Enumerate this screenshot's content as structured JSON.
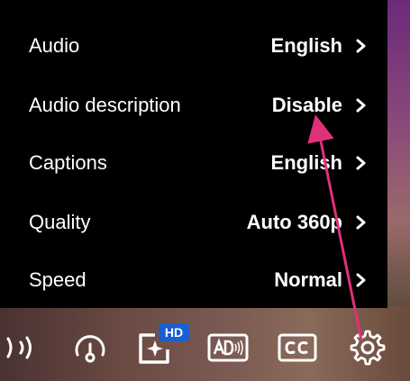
{
  "settings_menu": {
    "items": [
      {
        "label": "Audio",
        "value": "English"
      },
      {
        "label": "Audio description",
        "value": "Disable"
      },
      {
        "label": "Captions",
        "value": "English"
      },
      {
        "label": "Quality",
        "value": "Auto 360p"
      },
      {
        "label": "Speed",
        "value": "Normal"
      }
    ]
  },
  "controls": {
    "hd_badge": "HD",
    "icons": [
      "volume-icon",
      "speed-gauge-icon",
      "quality-sparkle-icon",
      "audio-description-icon",
      "closed-captions-icon",
      "gear-icon"
    ]
  },
  "colors": {
    "panel_bg": "#000000",
    "text": "#ffffff",
    "hd_badge": "#1a5fd0",
    "annotation_arrow": "#e0307a"
  }
}
